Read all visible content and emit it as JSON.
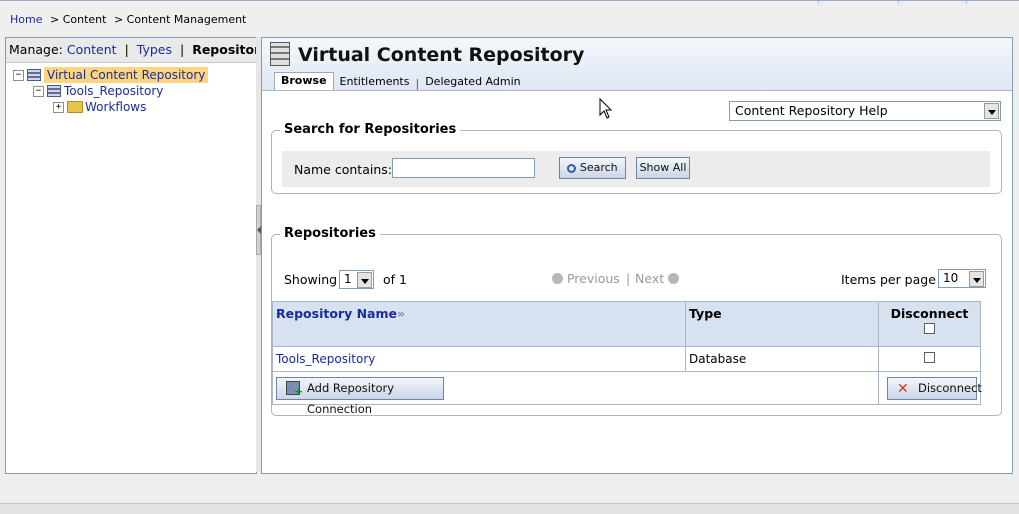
{
  "breadcrumb": {
    "home": "Home",
    "content": "> Content",
    "current": "> Content Management"
  },
  "manage": {
    "label": "Manage:",
    "content": "Content",
    "types": "Types",
    "repositories": "Repositories",
    "sep": "|"
  },
  "tree": {
    "root": "Virtual Content Repository",
    "child": "Tools_Repository",
    "grandchild": "Workflows"
  },
  "main": {
    "title": "Virtual Content Repository",
    "tabs": [
      "Browse",
      "Entitlements",
      "Delegated Admin"
    ],
    "tab_sep": "|",
    "help_select": "Content Repository Help"
  },
  "search": {
    "legend": "Search for Repositories",
    "label": "Name contains:",
    "value": "",
    "search_button": "Search",
    "show_all_button": "Show All"
  },
  "repositories": {
    "legend": "Repositories",
    "showing_label": "Showing",
    "page_value": "1",
    "of_label": "of 1",
    "previous": "Previous",
    "next": "Next",
    "pipe": "|",
    "items_per_page_label": "Items per page",
    "items_per_page_value": "10",
    "columns": [
      "Repository Name",
      "Type",
      "Disconnect"
    ],
    "rows": [
      {
        "name": "Tools_Repository",
        "type": "Database",
        "disconnect_checked": false
      }
    ],
    "add_button": "Add Repository Connection",
    "disconnect_button": "Disconnect"
  },
  "colors": {
    "link": "#1a2c9c",
    "selected_node_bg": "#fbd580",
    "header_bg": "#d7e1ef"
  }
}
